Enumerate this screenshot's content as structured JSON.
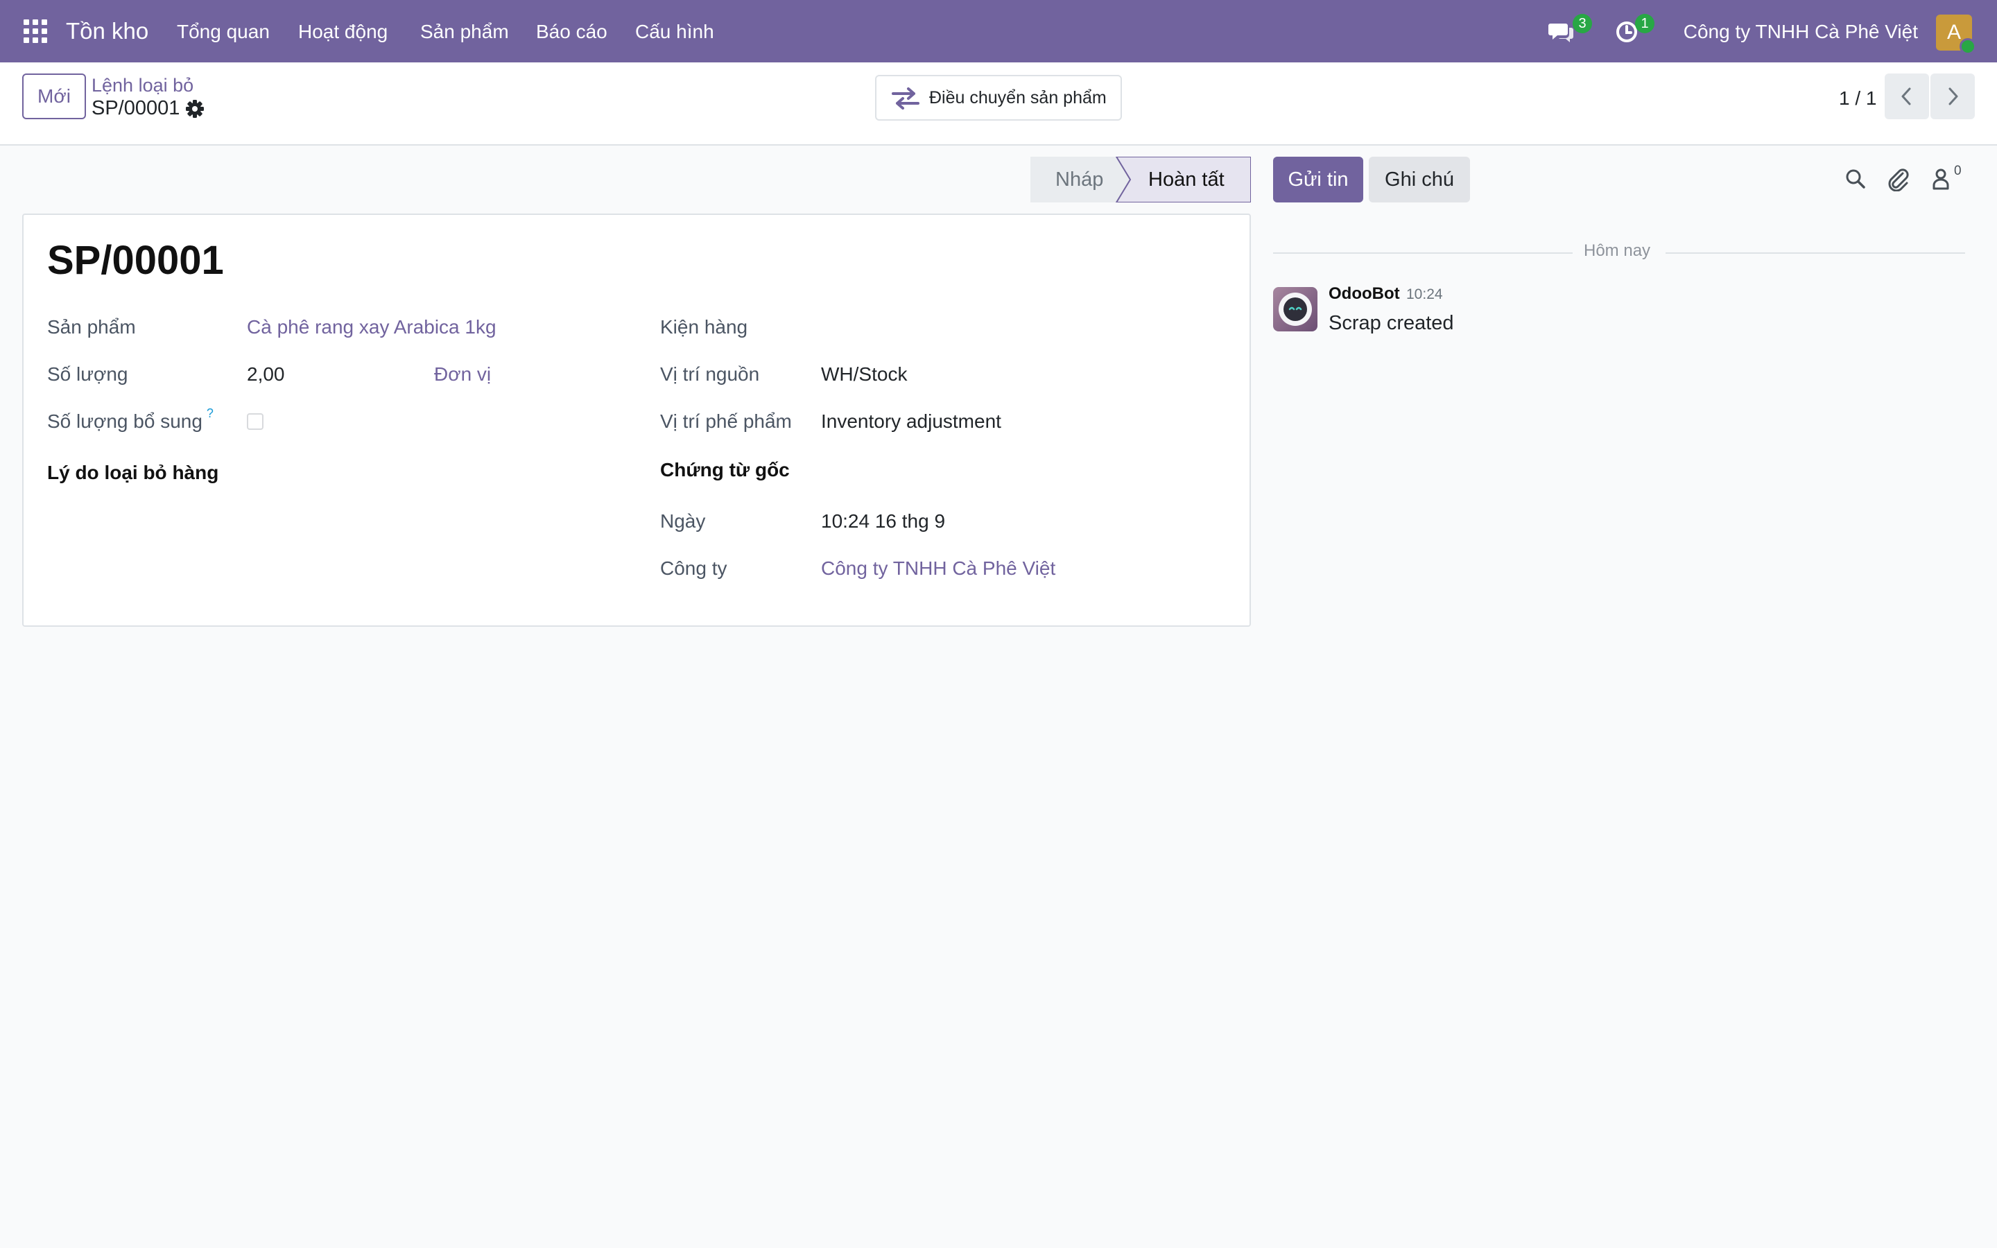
{
  "navbar": {
    "app_name": "Tồn kho",
    "menu": [
      "Tổng quan",
      "Hoạt động",
      "Sản phẩm",
      "Báo cáo",
      "Cấu hình"
    ],
    "messages_count": "3",
    "activities_count": "1",
    "company": "Công ty TNHH Cà Phê Việt",
    "avatar_initial": "A",
    "accent_color": "#71639e"
  },
  "control": {
    "new_button": "Mới",
    "breadcrumb_parent": "Lệnh loại bỏ",
    "breadcrumb_current": "SP/00001",
    "transfer_button": "Điều chuyển sản phẩm",
    "pager": "1 / 1"
  },
  "status": {
    "steps": [
      "Nháp",
      "Hoàn tất"
    ],
    "current": "Hoàn tất"
  },
  "form": {
    "title": "SP/00001",
    "product_label": "Sản phẩm",
    "product_value": "Cà phê rang xay Arabica 1kg",
    "quantity_label": "Số lượng",
    "quantity_value": "2,00",
    "uom_value": "Đơn vị",
    "replenish_label": "Số lượng bổ sung",
    "replenish_help": "?",
    "reason_label": "Lý do loại bỏ hàng",
    "package_label": "Kiện hàng",
    "source_location_label": "Vị trí nguồn",
    "source_location_value": "WH/Stock",
    "scrap_location_label": "Vị trí phế phẩm",
    "scrap_location_value": "Inventory adjustment",
    "source_document_label": "Chứng từ gốc",
    "date_label": "Ngày",
    "date_value": "10:24 16 thg 9",
    "company_label": "Công ty",
    "company_value": "Công ty TNHH Cà Phê Việt"
  },
  "chatter": {
    "send_message": "Gửi tin",
    "log_note": "Ghi chú",
    "followers_count": "0",
    "day_separator": "Hôm nay",
    "messages": [
      {
        "author": "OdooBot",
        "time": "10:24",
        "body": "Scrap created"
      }
    ]
  }
}
